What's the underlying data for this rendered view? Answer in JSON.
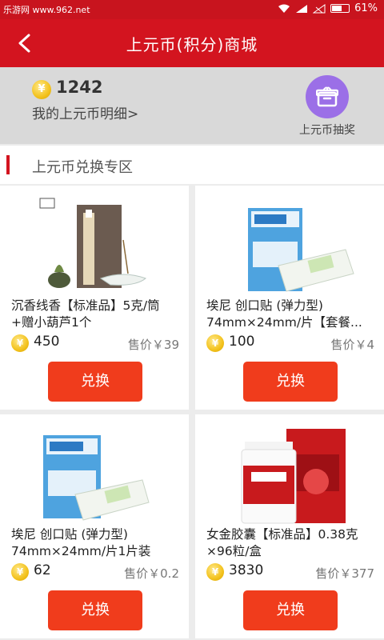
{
  "status_bar": {
    "watermark": "乐游网 www.962.net",
    "battery": "61%",
    "battery_level": 0.61
  },
  "header": {
    "title": "上元币(积分)商城"
  },
  "points": {
    "coin_symbol": "¥",
    "balance": "1242",
    "detail_link": "我的上元币明细>"
  },
  "lottery": {
    "label": "上元币抽奖"
  },
  "section": {
    "title": "上元币兑换专区"
  },
  "products": [
    {
      "name": "沉香线香【标准品】5克/筒+赠小葫芦1个",
      "cost": "450",
      "price": "售价￥39",
      "button": "兑换",
      "image": "incense-image"
    },
    {
      "name": "埃尼 创口贴 (弹力型) 74mm×24mm/片【套餐...",
      "cost": "100",
      "price": "售价￥4",
      "button": "兑换",
      "image": "bandage-box-image"
    },
    {
      "name": "埃尼 创口贴 (弹力型) 74mm×24mm/片1片装",
      "cost": "62",
      "price": "售价￥0.2",
      "button": "兑换",
      "image": "bandage-box-image"
    },
    {
      "name": "女金胶囊【标准品】0.38克×96粒/盒",
      "cost": "3830",
      "price": "售价￥377",
      "button": "兑换",
      "image": "capsule-box-image"
    }
  ],
  "colors": {
    "header_red": "#d3141f",
    "button_orange": "#f03c1c",
    "coin_gold": "#f3c21d",
    "lottery_purple": "#9b6fe7"
  }
}
